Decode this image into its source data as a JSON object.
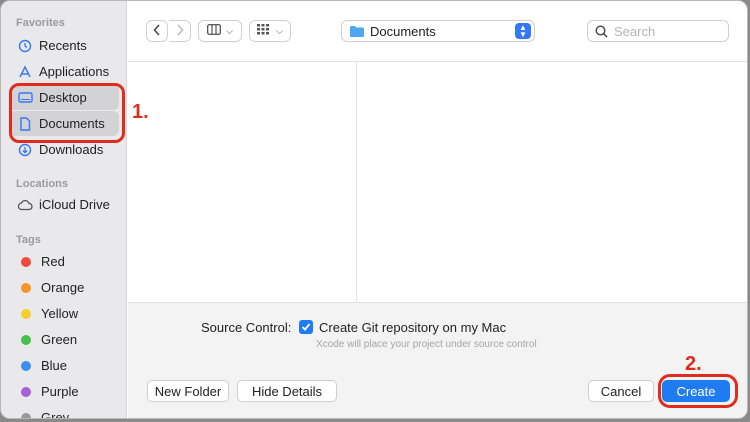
{
  "sidebar": {
    "favorites_label": "Favorites",
    "favorites": [
      {
        "label": "Recents",
        "icon": "clock-icon"
      },
      {
        "label": "Applications",
        "icon": "applications-icon"
      },
      {
        "label": "Desktop",
        "icon": "desktop-icon"
      },
      {
        "label": "Documents",
        "icon": "document-icon"
      },
      {
        "label": "Downloads",
        "icon": "download-icon"
      }
    ],
    "locations_label": "Locations",
    "locations": [
      {
        "label": "iCloud Drive",
        "icon": "cloud-icon"
      }
    ],
    "tags_label": "Tags",
    "tags": [
      {
        "label": "Red",
        "color": "#f2473d"
      },
      {
        "label": "Orange",
        "color": "#f7922b"
      },
      {
        "label": "Yellow",
        "color": "#f6cf2d"
      },
      {
        "label": "Green",
        "color": "#47c04c"
      },
      {
        "label": "Blue",
        "color": "#3a8ef0"
      },
      {
        "label": "Purple",
        "color": "#a85ed8"
      },
      {
        "label": "Grey",
        "color": "#9a9a9a"
      }
    ]
  },
  "toolbar": {
    "location": "Documents",
    "search_placeholder": "Search"
  },
  "options": {
    "source_control_label": "Source Control:",
    "git_checkbox_label": "Create Git repository on my Mac",
    "git_checked": true,
    "hint": "Xcode will place your project under source control"
  },
  "footer": {
    "new_folder": "New Folder",
    "hide_details": "Hide Details",
    "cancel": "Cancel",
    "create": "Create"
  },
  "annotations": {
    "step1": "1.",
    "step2": "2."
  },
  "colors": {
    "accent": "#1f7bf2",
    "annotation": "#e12b1c"
  }
}
